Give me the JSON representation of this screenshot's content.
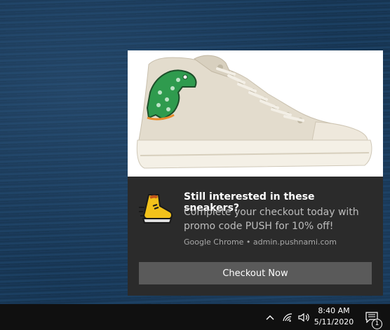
{
  "notification": {
    "hero_image_alt": "Cream high-top canvas sneaker with green dinosaur graphic",
    "app_icon": "running-sneaker-icon",
    "title": "Still interested in these sneakers?",
    "body": "Complete your checkout today with promo code PUSH for 10% off!",
    "attribution": "Google Chrome • admin.pushnami.com",
    "action_button_label": "Checkout Now"
  },
  "taskbar": {
    "tray_icons": [
      "chevron-up-icon",
      "wifi-icon",
      "volume-icon"
    ],
    "time": "8:40 AM",
    "date": "5/11/2020",
    "action_center_icon": "action-center-icon",
    "action_center_badge": "1"
  },
  "colors": {
    "toast_background": "#2b2b2b",
    "button_background": "#5a5a5a",
    "taskbar_background": "#101010"
  }
}
